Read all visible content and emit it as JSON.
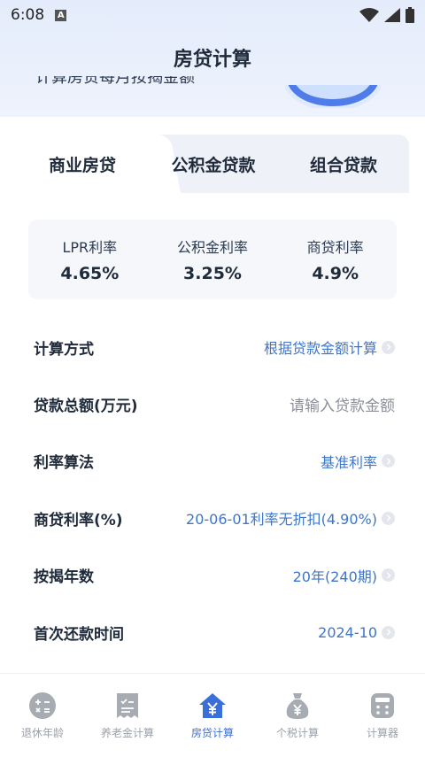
{
  "status_bar": {
    "time": "6:08",
    "notification_letter": "A"
  },
  "app_bar": {
    "title": "房贷计算"
  },
  "banner": {
    "text": "计算房贷每月按揭金额"
  },
  "tabs": [
    {
      "label": "商业房贷",
      "active": true
    },
    {
      "label": "公积金贷款",
      "active": false
    },
    {
      "label": "组合贷款",
      "active": false
    }
  ],
  "rates": [
    {
      "label": "LPR利率",
      "value": "4.65%"
    },
    {
      "label": "公积金利率",
      "value": "3.25%"
    },
    {
      "label": "商贷利率",
      "value": "4.9%"
    }
  ],
  "form": [
    {
      "label": "计算方式",
      "value": "根据贷款金额计算",
      "placeholder": false,
      "chevron": true
    },
    {
      "label": "贷款总额(万元)",
      "value": "请输入贷款金额",
      "placeholder": true,
      "chevron": false
    },
    {
      "label": "利率算法",
      "value": "基准利率",
      "placeholder": false,
      "chevron": true
    },
    {
      "label": "商贷利率(%)",
      "value": "20-06-01利率无折扣(4.90%)",
      "placeholder": false,
      "chevron": true
    },
    {
      "label": "按揭年数",
      "value": "20年(240期)",
      "placeholder": false,
      "chevron": true
    },
    {
      "label": "首次还款时间",
      "value": "2024-10",
      "placeholder": false,
      "chevron": true
    }
  ],
  "bottom_nav": [
    {
      "label": "退休年龄",
      "icon": "calculator-ops-icon",
      "active": false
    },
    {
      "label": "养老金计算",
      "icon": "receipt-icon",
      "active": false
    },
    {
      "label": "房贷计算",
      "icon": "house-yen-icon",
      "active": true
    },
    {
      "label": "个税计算",
      "icon": "money-bag-icon",
      "active": false
    },
    {
      "label": "计算器",
      "icon": "calculator-icon",
      "active": false
    }
  ],
  "colors": {
    "accent": "#3a6fd9",
    "link": "#3f76c9",
    "inactive_icon": "#a7acb3"
  }
}
